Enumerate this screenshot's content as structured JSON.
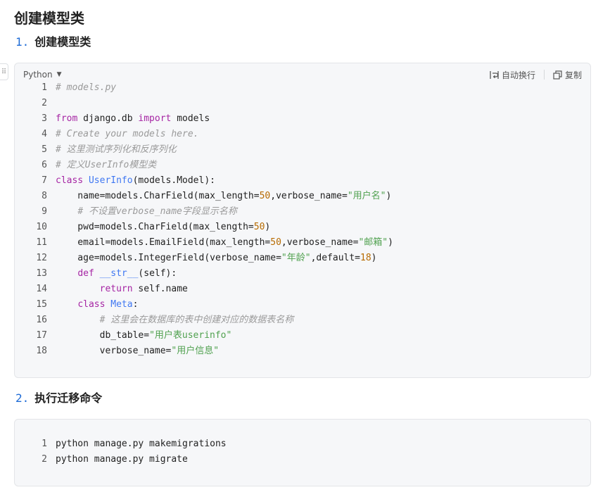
{
  "page": {
    "title": "创建模型类"
  },
  "sections": [
    {
      "number": "1.",
      "title": "创建模型类"
    },
    {
      "number": "2.",
      "title": "执行迁移命令"
    }
  ],
  "code_block_1": {
    "language": "Python",
    "wrap_label": "自动换行",
    "copy_label": "复制",
    "lines": [
      "# models.py",
      "",
      "from django.db import models",
      "# Create your models here.",
      "# 这里测试序列化和反序列化",
      "# 定义UserInfo模型类",
      "class UserInfo(models.Model):",
      "    name=models.CharField(max_length=50,verbose_name=\"用户名\")",
      "    # 不设置verbose_name字段显示名称",
      "    pwd=models.CharField(max_length=50)",
      "    email=models.EmailField(max_length=50,verbose_name=\"邮箱\")",
      "    age=models.IntegerField(verbose_name=\"年龄\",default=18)",
      "    def __str__(self):",
      "        return self.name",
      "    class Meta:",
      "        # 这里会在数据库的表中创建对应的数据表名称",
      "        db_table=\"用户表userinfo\"",
      "        verbose_name=\"用户信息\""
    ]
  },
  "code_block_2": {
    "lines": [
      "python manage.py makemigrations",
      "python manage.py migrate"
    ]
  },
  "icons": {
    "drag": "drag-handle-icon",
    "wrap": "wrap-text-icon",
    "copy": "copy-icon",
    "caret": "caret-down-icon"
  }
}
